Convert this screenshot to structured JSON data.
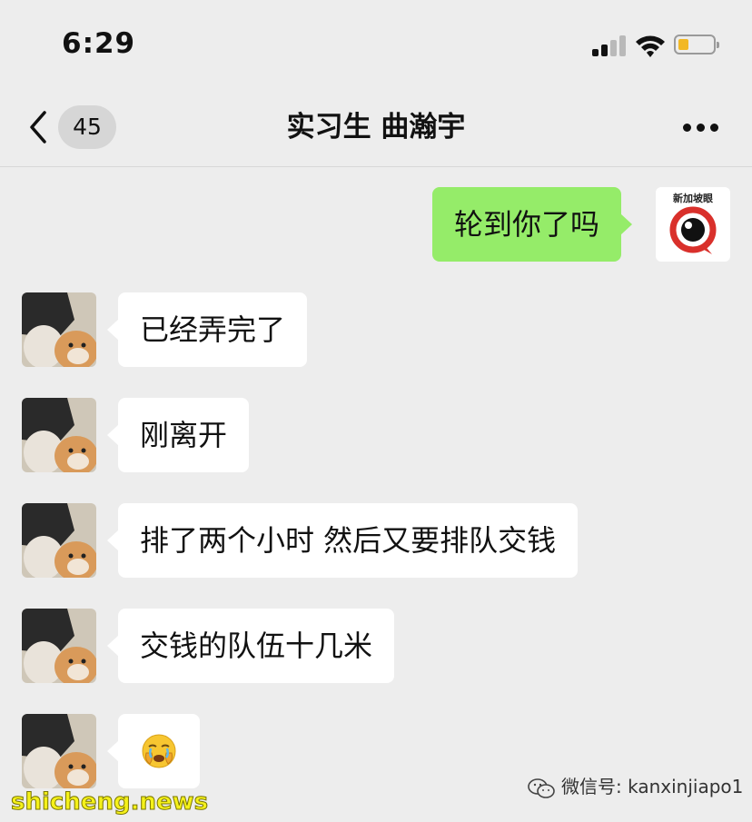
{
  "status_bar": {
    "time": "6:29"
  },
  "header": {
    "unread_count": "45",
    "title": "实习生 曲瀚宇"
  },
  "logo_avatar": {
    "text": "新加坡眼"
  },
  "messages": [
    {
      "side": "out",
      "text": "轮到你了吗"
    },
    {
      "side": "in",
      "text": "已经弄完了"
    },
    {
      "side": "in",
      "text": "刚离开"
    },
    {
      "side": "in",
      "text": "排了两个小时 然后又要排队交钱"
    },
    {
      "side": "in",
      "text": "交钱的队伍十几米"
    },
    {
      "side": "in",
      "emoji": "crying-face"
    }
  ],
  "watermarks": {
    "wechat": "微信号: kanxinjiapo1",
    "site": "shicheng.news"
  },
  "colors": {
    "outgoing_bubble": "#95ec69",
    "incoming_bubble": "#ffffff",
    "background": "#ededed"
  }
}
